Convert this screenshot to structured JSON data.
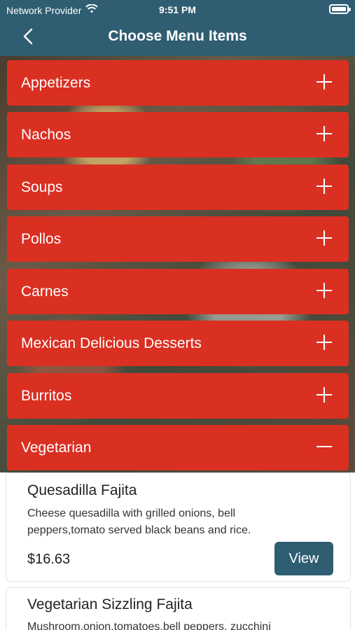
{
  "status_bar": {
    "carrier": "Network Provider",
    "time": "9:51 PM",
    "wifi_icon": "wifi-icon",
    "battery_icon": "battery-icon"
  },
  "header": {
    "title": "Choose Menu Items",
    "back_icon": "chevron-left-icon"
  },
  "categories": [
    {
      "label": "Appetizers",
      "expanded": false,
      "icon": "plus-icon"
    },
    {
      "label": "Nachos",
      "expanded": false,
      "icon": "plus-icon"
    },
    {
      "label": "Soups",
      "expanded": false,
      "icon": "plus-icon"
    },
    {
      "label": "Pollos",
      "expanded": false,
      "icon": "plus-icon"
    },
    {
      "label": "Carnes",
      "expanded": false,
      "icon": "plus-icon"
    },
    {
      "label": "Mexican Delicious Desserts",
      "expanded": false,
      "icon": "plus-icon"
    },
    {
      "label": "Burritos",
      "expanded": false,
      "icon": "plus-icon"
    },
    {
      "label": "Vegetarian",
      "expanded": true,
      "icon": "minus-icon"
    }
  ],
  "items": [
    {
      "name": "Quesadilla Fajita",
      "description": "Cheese quesadilla with grilled onions, bell peppers,tomato served black beans and rice.",
      "price": "$16.63",
      "view_label": "View"
    },
    {
      "name": "Vegetarian Sizzling Fajita",
      "description": "Mushroom,onion,tomatoes,bell peppers, zucchini"
    }
  ],
  "colors": {
    "header": "#2f5d72",
    "category": "#d93022",
    "button": "#2f5d72"
  }
}
